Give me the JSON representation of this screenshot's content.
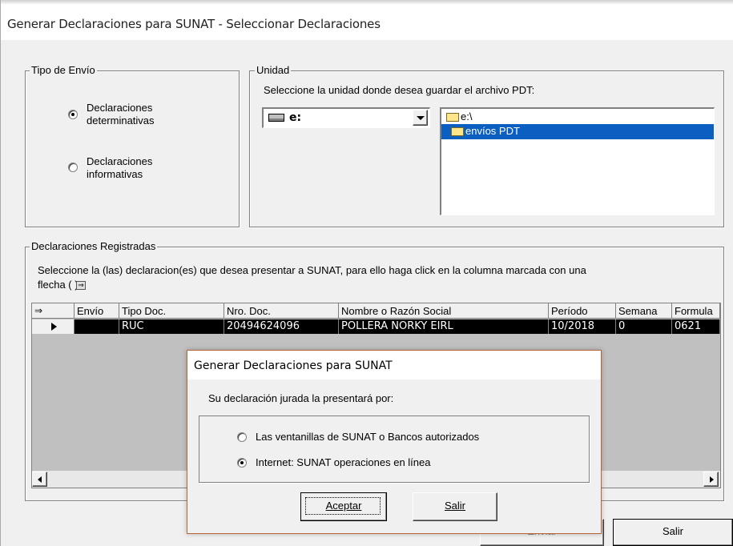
{
  "window": {
    "title": "Generar Declaraciones para SUNAT - Seleccionar Declaraciones"
  },
  "tipo_envio": {
    "title": "Tipo de Envío",
    "options": [
      {
        "line1": "Declaraciones",
        "line2": "determinativas",
        "selected": true
      },
      {
        "line1": "Declaraciones",
        "line2": "informativas",
        "selected": false
      }
    ]
  },
  "unidad": {
    "title": "Unidad",
    "prompt": "Seleccione la unidad donde desea guardar el archivo PDT:",
    "drive": "e:",
    "folders": [
      {
        "name": "e:\\",
        "selected": false
      },
      {
        "name": "envíos PDT",
        "selected": true
      }
    ]
  },
  "registradas": {
    "title": "Declaraciones Registradas",
    "instruction_line1": "Seleccione la (las) declaracion(es) que desea presentar a SUNAT, para ello haga click en la columna marcada con una",
    "instruction_line2": "flecha (  ) :",
    "columns": [
      "Envío",
      "Tipo Doc.",
      "Nro. Doc.",
      "Nombre o Razón Social",
      "Período",
      "Semana",
      "Formula"
    ],
    "rows": [
      {
        "envio": "",
        "tipo_doc": "RUC",
        "nro_doc": "20494624096",
        "nombre": "POLLERA NORKY EIRL",
        "periodo": "10/2018",
        "semana": "0",
        "formula": "0621"
      }
    ]
  },
  "footer": {
    "enviar": "Enviar",
    "salir": "Salir"
  },
  "dialog": {
    "title": "Generar Declaraciones para SUNAT",
    "question": "Su declaración jurada la presentará por:",
    "options": [
      {
        "label": "Las ventanillas de SUNAT o  Bancos autorizados",
        "selected": false
      },
      {
        "label": "Internet: SUNAT operaciones en línea",
        "selected": true
      }
    ],
    "accept": "Aceptar",
    "exit": "Salir"
  }
}
